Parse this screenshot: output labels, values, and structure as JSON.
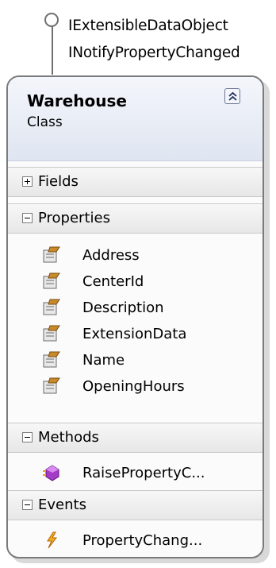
{
  "interfaces": [
    "IExtensibleDataObject",
    "INotifyPropertyChanged"
  ],
  "class": {
    "name": "Warehouse",
    "kind": "Class"
  },
  "sections": {
    "fields": {
      "label": "Fields",
      "state": "collapsed"
    },
    "properties": {
      "label": "Properties",
      "state": "expanded",
      "items": [
        "Address",
        "CenterId",
        "Description",
        "ExtensionData",
        "Name",
        "OpeningHours"
      ]
    },
    "methods": {
      "label": "Methods",
      "state": "expanded",
      "items": [
        "RaisePropertyC..."
      ]
    },
    "events": {
      "label": "Events",
      "state": "expanded",
      "items": [
        "PropertyChang..."
      ]
    }
  },
  "icons": {
    "property": "property-icon",
    "method": "method-icon",
    "event": "event-icon",
    "collapse": "collapse-chevron-icon"
  }
}
